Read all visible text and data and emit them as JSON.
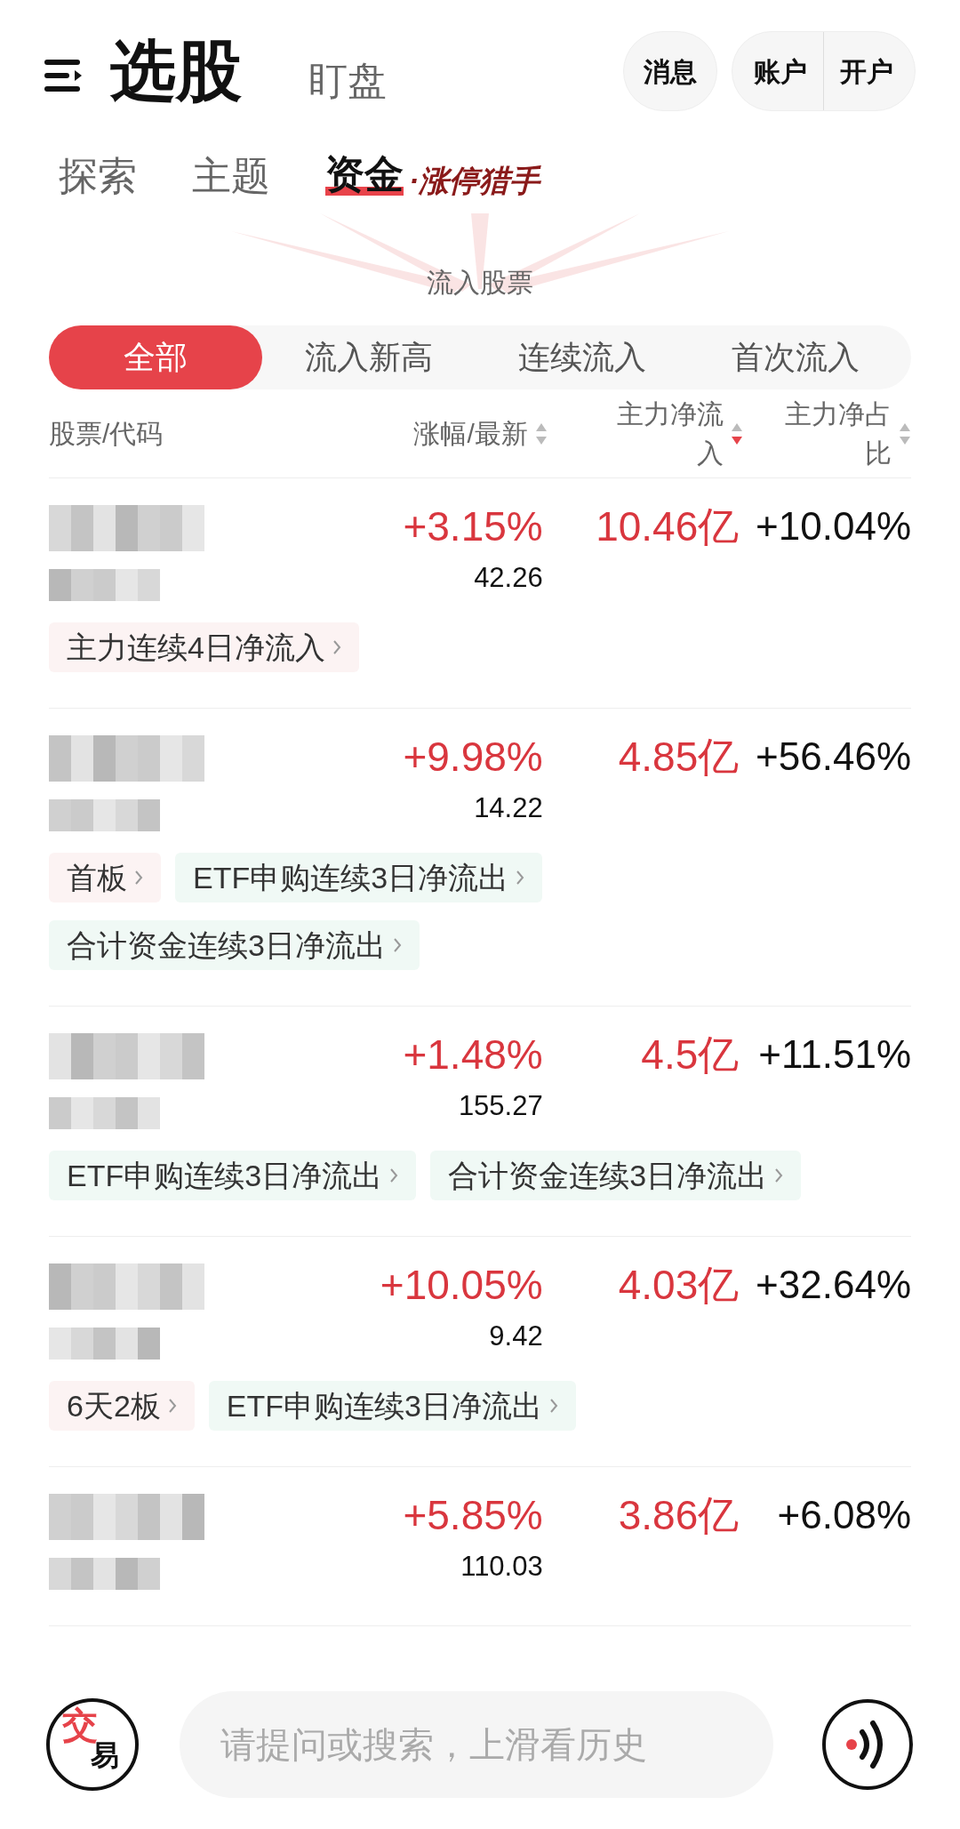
{
  "header": {
    "views": [
      {
        "label": "选股",
        "selected": true
      },
      {
        "label": "盯盘",
        "selected": false
      }
    ],
    "buttons": [
      {
        "label": "消息"
      }
    ],
    "account_group": [
      {
        "label": "账户"
      },
      {
        "label": "开户"
      }
    ]
  },
  "tabs": [
    {
      "label": "探索",
      "selected": false
    },
    {
      "label": "主题",
      "selected": false
    },
    {
      "label": "资金",
      "selected": true,
      "slogan": "·涨停猎手"
    }
  ],
  "section_title": "流入股票",
  "filters": [
    {
      "label": "全部",
      "selected": true
    },
    {
      "label": "流入新高",
      "selected": false
    },
    {
      "label": "连续流入",
      "selected": false
    },
    {
      "label": "首次流入",
      "selected": false
    }
  ],
  "columns": [
    {
      "label": "股票/代码",
      "sortable": false
    },
    {
      "label": "涨幅/最新",
      "sortable": true,
      "selected": false
    },
    {
      "label": "主力净流入",
      "sortable": true,
      "selected": true
    },
    {
      "label": "主力净占比",
      "sortable": true,
      "selected": false
    }
  ],
  "rows": [
    {
      "change": "+3.15%",
      "price": "42.26",
      "inflow": "10.46亿",
      "ratio": "+10.04%",
      "tags": [
        {
          "label": "主力连续4日净流入",
          "color": "#fcf3f3"
        }
      ]
    },
    {
      "change": "+9.98%",
      "price": "14.22",
      "inflow": "4.85亿",
      "ratio": "+56.46%",
      "tags": [
        {
          "label": "首板",
          "color": "#fcf3f3"
        },
        {
          "label": "ETF申购连续3日净流出",
          "color": "#f0f9f5"
        },
        {
          "label": "合计资金连续3日净流出",
          "color": "#f0f9f5"
        }
      ]
    },
    {
      "change": "+1.48%",
      "price": "155.27",
      "inflow": "4.5亿",
      "ratio": "+11.51%",
      "tags": [
        {
          "label": "ETF申购连续3日净流出",
          "color": "#f0f9f5"
        },
        {
          "label": "合计资金连续3日净流出",
          "color": "#f0f9f5"
        }
      ]
    },
    {
      "change": "+10.05%",
      "price": "9.42",
      "inflow": "4.03亿",
      "ratio": "+32.64%",
      "tags": [
        {
          "label": "6天2板",
          "color": "#fcf3f3"
        },
        {
          "label": "ETF申购连续3日净流出",
          "color": "#f0f9f5"
        }
      ]
    },
    {
      "change": "+5.85%",
      "price": "110.03",
      "inflow": "3.86亿",
      "ratio": "+6.08%",
      "tags": []
    }
  ],
  "bottom_bar": {
    "trade_icon": [
      "交",
      "易"
    ],
    "search": {
      "placeholder": "请提问或搜索，上滑看历史"
    }
  }
}
